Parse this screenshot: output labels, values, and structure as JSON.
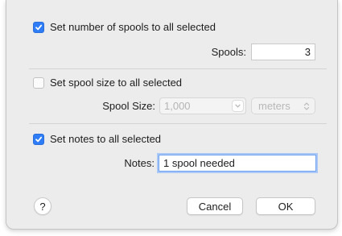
{
  "section_spools": {
    "checkbox_label": "Set number of spools to all selected",
    "checked": true,
    "field_label": "Spools:",
    "field_value": "3"
  },
  "section_size": {
    "checkbox_label": "Set spool size to all selected",
    "checked": false,
    "field_label": "Spool Size:",
    "combo_value": "1,000",
    "unit_value": "meters"
  },
  "section_notes": {
    "checkbox_label": "Set notes to all selected",
    "checked": true,
    "field_label": "Notes:",
    "field_value": "1 spool needed"
  },
  "footer": {
    "help_label": "?",
    "cancel_label": "Cancel",
    "ok_label": "OK"
  },
  "colors": {
    "accent": "#2f7df6",
    "focus_ring": "#a9c8f6",
    "sheet_bg": "#ececec"
  }
}
